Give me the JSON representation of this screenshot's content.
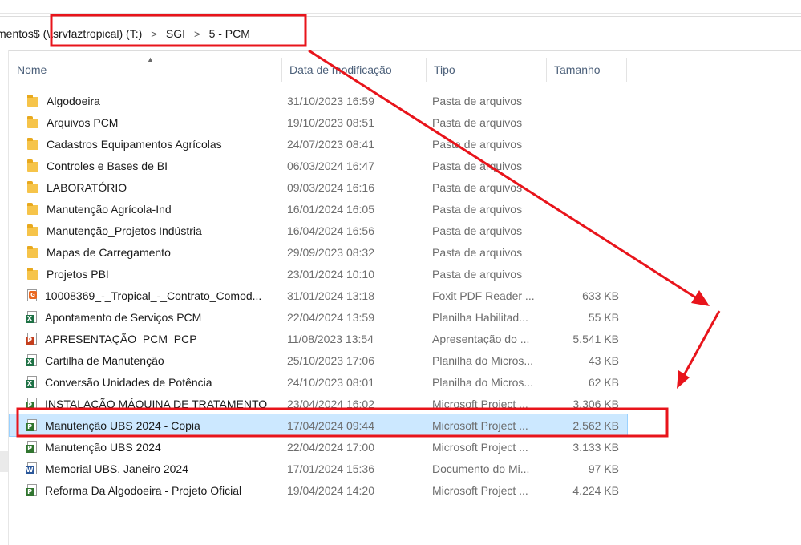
{
  "address_bar": {
    "crumbs": [
      "mentos$ (\\\\srvfaztropical) (T:)",
      "SGI",
      "5 - PCM"
    ],
    "separator": ">"
  },
  "columns": {
    "name": "Nome",
    "date": "Data de modificação",
    "type": "Tipo",
    "size": "Tamanho"
  },
  "files": [
    {
      "name": "Algodoeira",
      "date": "31/10/2023 16:59",
      "type": "Pasta de arquivos",
      "size": "",
      "icon": "folder-icon"
    },
    {
      "name": "Arquivos PCM",
      "date": "19/10/2023 08:51",
      "type": "Pasta de arquivos",
      "size": "",
      "icon": "folder-icon"
    },
    {
      "name": "Cadastros Equipamentos Agrícolas",
      "date": "24/07/2023 08:41",
      "type": "Pasta de arquivos",
      "size": "",
      "icon": "folder-icon"
    },
    {
      "name": "Controles e Bases de BI",
      "date": "06/03/2024 16:47",
      "type": "Pasta de arquivos",
      "size": "",
      "icon": "folder-icon"
    },
    {
      "name": "LABORATÓRIO",
      "date": "09/03/2024 16:16",
      "type": "Pasta de arquivos",
      "size": "",
      "icon": "folder-icon"
    },
    {
      "name": "Manutenção Agrícola-Ind",
      "date": "16/01/2024 16:05",
      "type": "Pasta de arquivos",
      "size": "",
      "icon": "folder-icon"
    },
    {
      "name": "Manutenção_Projetos Indústria",
      "date": "16/04/2024 16:56",
      "type": "Pasta de arquivos",
      "size": "",
      "icon": "folder-icon"
    },
    {
      "name": "Mapas de Carregamento",
      "date": "29/09/2023 08:32",
      "type": "Pasta de arquivos",
      "size": "",
      "icon": "folder-icon"
    },
    {
      "name": "Projetos PBI",
      "date": "23/01/2024 10:10",
      "type": "Pasta de arquivos",
      "size": "",
      "icon": "folder-icon"
    },
    {
      "name": "10008369_-_Tropical_-_Contrato_Comod...",
      "date": "31/01/2024 13:18",
      "type": "Foxit PDF Reader ...",
      "size": "633 KB",
      "icon": "pdf-file-icon"
    },
    {
      "name": "Apontamento de Serviços PCM",
      "date": "22/04/2024 13:59",
      "type": "Planilha Habilitad...",
      "size": "55 KB",
      "icon": "excel-file-icon"
    },
    {
      "name": "APRESENTAÇÃO_PCM_PCP",
      "date": "11/08/2023 13:54",
      "type": "Apresentação do ...",
      "size": "5.541 KB",
      "icon": "powerpoint-file-icon"
    },
    {
      "name": "Cartilha de Manutenção",
      "date": "25/10/2023 17:06",
      "type": "Planilha do Micros...",
      "size": "43 KB",
      "icon": "excel-file-icon"
    },
    {
      "name": "Conversão Unidades de Potência",
      "date": "24/10/2023 08:01",
      "type": "Planilha do Micros...",
      "size": "62 KB",
      "icon": "excel-file-icon"
    },
    {
      "name": "INSTALAÇÃO MÁQUINA DE TRATAMENTO",
      "date": "23/04/2024 16:02",
      "type": "Microsoft Project ...",
      "size": "3.306 KB",
      "icon": "project-file-icon"
    },
    {
      "name": "Manutenção UBS 2024 - Copia",
      "date": "17/04/2024 09:44",
      "type": "Microsoft Project ...",
      "size": "2.562 KB",
      "icon": "project-file-icon",
      "selected": true
    },
    {
      "name": "Manutenção UBS 2024",
      "date": "22/04/2024 17:00",
      "type": "Microsoft Project ...",
      "size": "3.133 KB",
      "icon": "project-file-icon"
    },
    {
      "name": "Memorial UBS, Janeiro 2024",
      "date": "17/01/2024 15:36",
      "type": "Documento do Mi...",
      "size": "97 KB",
      "icon": "word-file-icon"
    },
    {
      "name": "Reforma Da Algodoeira - Projeto Oficial",
      "date": "19/04/2024 14:20",
      "type": "Microsoft Project ...",
      "size": "4.224 KB",
      "icon": "project-file-icon"
    }
  ],
  "colors": {
    "annotation_red": "#e8141b",
    "selection_fill": "#cce8ff",
    "folder_yellow": "#f6c44a"
  }
}
